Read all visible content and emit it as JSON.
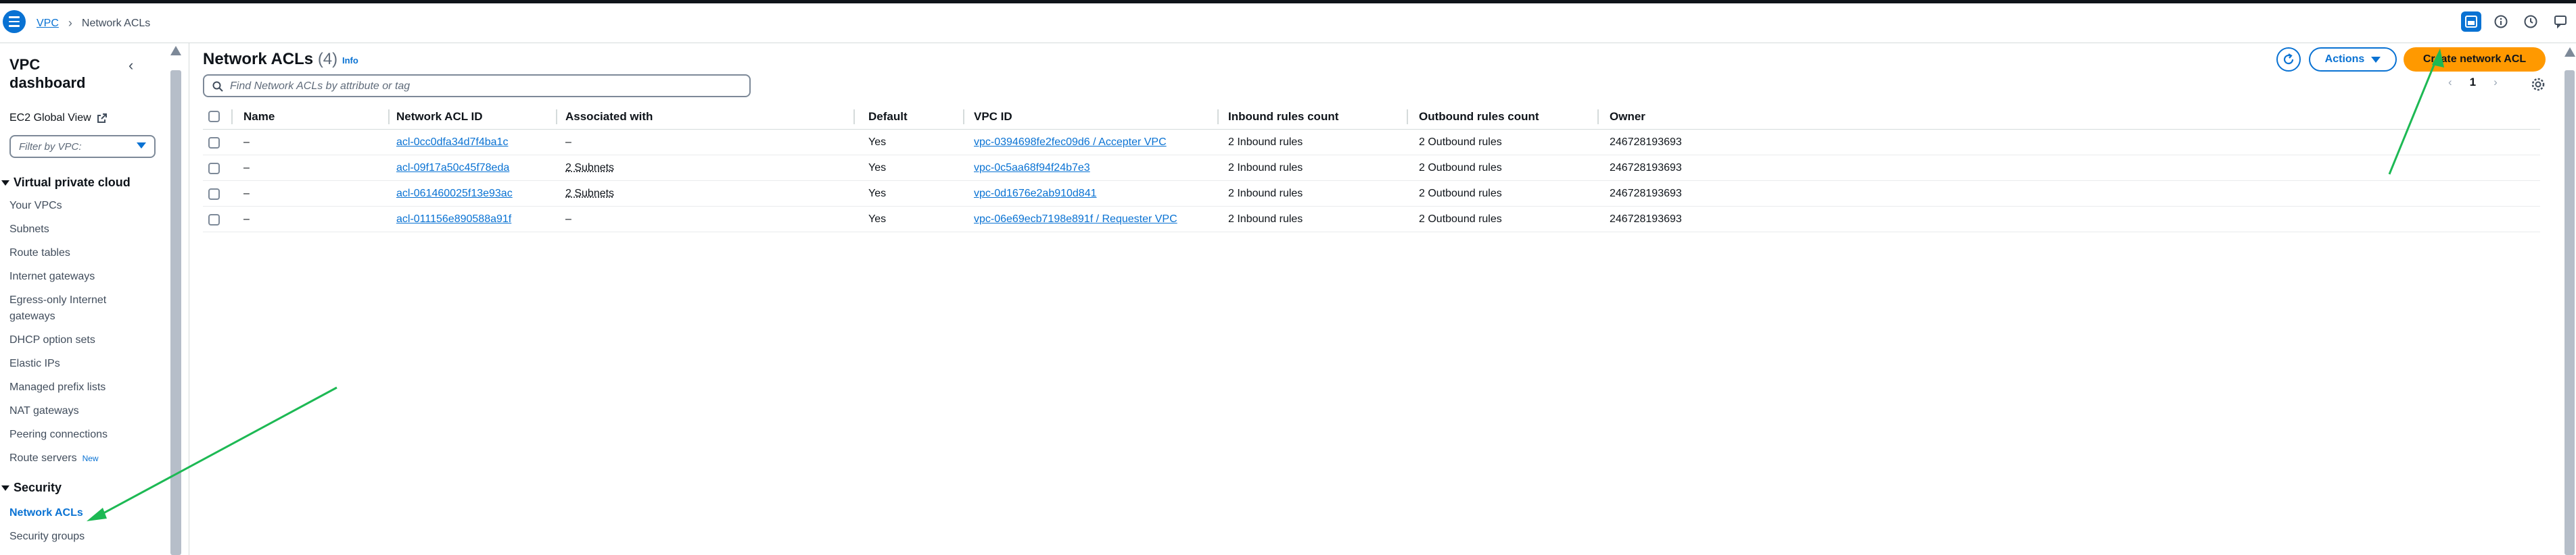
{
  "breadcrumb": {
    "root": "VPC",
    "current": "Network ACLs"
  },
  "sidebar": {
    "title": "VPC dashboard",
    "ec2_global_view": "EC2 Global View",
    "filter_placeholder": "Filter by VPC:",
    "section_vpc": "Virtual private cloud",
    "vpc_items": [
      "Your VPCs",
      "Subnets",
      "Route tables",
      "Internet gateways",
      "Egress-only Internet gateways",
      "DHCP option sets",
      "Elastic IPs",
      "Managed prefix lists",
      "NAT gateways",
      "Peering connections",
      "Route servers"
    ],
    "route_servers_badge": "New",
    "section_security": "Security",
    "security_items": [
      "Network ACLs",
      "Security groups"
    ],
    "active_item": "Network ACLs"
  },
  "header": {
    "title": "Network ACLs",
    "count": "(4)",
    "info": "Info",
    "actions_label": "Actions",
    "create_label": "Create network ACL",
    "search_placeholder": "Find Network ACLs by attribute or tag",
    "current_page": "1"
  },
  "table": {
    "columns": [
      "Name",
      "Network ACL ID",
      "Associated with",
      "Default",
      "VPC ID",
      "Inbound rules count",
      "Outbound rules count",
      "Owner"
    ],
    "rows": [
      {
        "name": "–",
        "acl_id": "acl-0cc0dfa34d7f4ba1c",
        "associated": "–",
        "default": "Yes",
        "vpc_id": "vpc-0394698fe2fec09d6 / Accepter VPC",
        "inbound": "2 Inbound rules",
        "outbound": "2 Outbound rules",
        "owner": "246728193693"
      },
      {
        "name": "–",
        "acl_id": "acl-09f17a50c45f78eda",
        "associated": "2 Subnets",
        "default": "Yes",
        "vpc_id": "vpc-0c5aa68f94f24b7e3",
        "inbound": "2 Inbound rules",
        "outbound": "2 Outbound rules",
        "owner": "246728193693"
      },
      {
        "name": "–",
        "acl_id": "acl-061460025f13e93ac",
        "associated": "2 Subnets",
        "default": "Yes",
        "vpc_id": "vpc-0d1676e2ab910d841",
        "inbound": "2 Inbound rules",
        "outbound": "2 Outbound rules",
        "owner": "246728193693"
      },
      {
        "name": "–",
        "acl_id": "acl-011156e890588a91f",
        "associated": "–",
        "default": "Yes",
        "vpc_id": "vpc-06e69ecb7198e891f / Requester VPC",
        "inbound": "2 Inbound rules",
        "outbound": "2 Outbound rules",
        "owner": "246728193693"
      }
    ]
  },
  "icons": {
    "menu": "hamburger-menu-icon",
    "refresh": "refresh-icon",
    "search": "search-icon",
    "settings": "gear-icon",
    "external": "external-link-icon",
    "annotation": "green-arrow-annotation"
  },
  "colors": {
    "accent": "#0972d3",
    "primary_button": "#ff9900",
    "annotation": "#1db954"
  }
}
